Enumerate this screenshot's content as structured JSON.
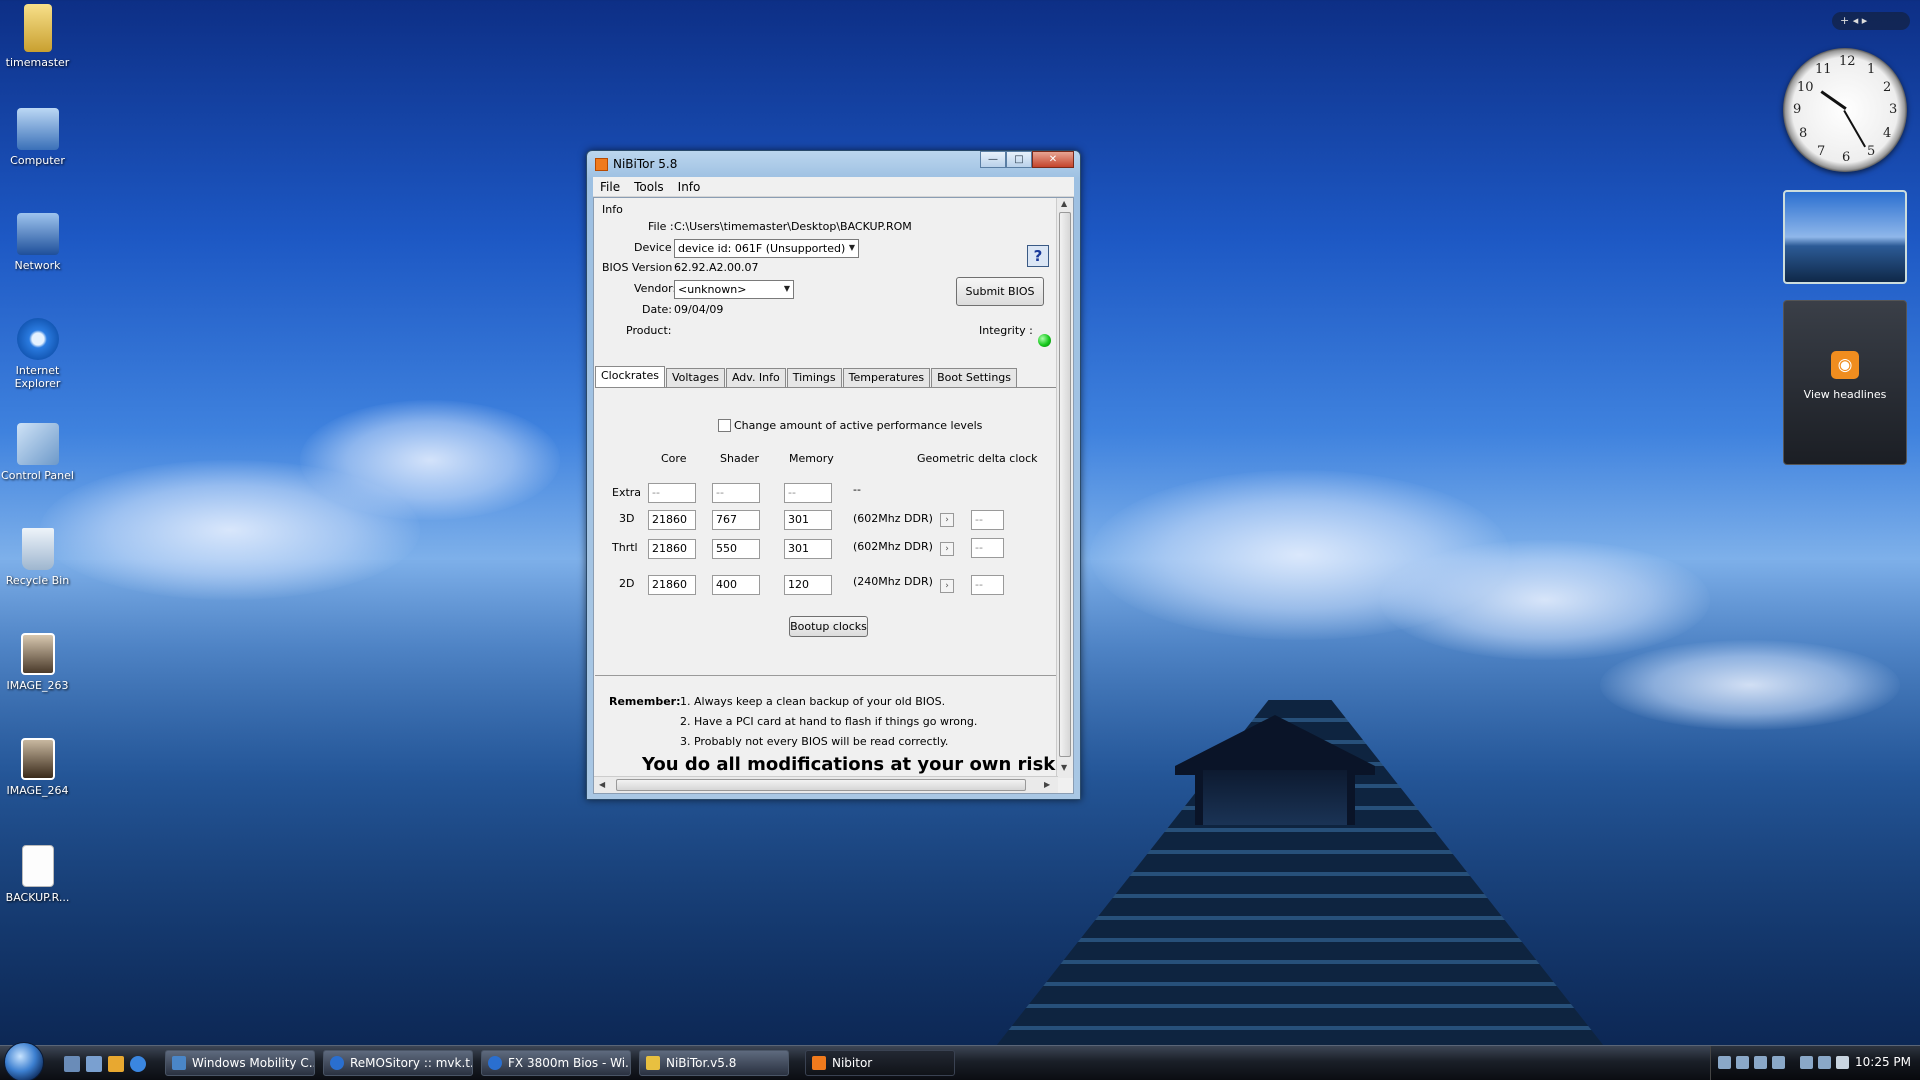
{
  "desktop": {
    "icons": [
      {
        "label": "timemaster"
      },
      {
        "label": "Computer"
      },
      {
        "label": "Network"
      },
      {
        "label": "Internet Explorer"
      },
      {
        "label": "Control Panel"
      },
      {
        "label": "Recycle Bin"
      },
      {
        "label": "IMAGE_263"
      },
      {
        "label": "IMAGE_264"
      },
      {
        "label": "BACKUP.R..."
      }
    ]
  },
  "sidebar": {
    "controls": "+  ◂ ▸",
    "rss_label": "View headlines"
  },
  "window": {
    "title": "NiBiTor 5.8",
    "controls": {
      "minimize": "—",
      "maximize": "□",
      "close": "✕"
    },
    "menu": [
      "File",
      "Tools",
      "Info"
    ],
    "info": {
      "section_label": "Info",
      "file_label": "File :",
      "file_value": "C:\\Users\\timemaster\\Desktop\\BACKUP.ROM",
      "device_label": "Device :",
      "device_value": "device id: 061F (Unsupported)",
      "bios_label": "BIOS Version :",
      "bios_value": "62.92.A2.00.07",
      "vendor_label": "Vendor:",
      "vendor_value": "<unknown>",
      "date_label": "Date:",
      "date_value": "09/04/09",
      "product_label": "Product:",
      "integrity_label": "Integrity :",
      "submit_label": "Submit BIOS",
      "help_glyph": "?"
    },
    "tabs": [
      "Clockrates",
      "Voltages",
      "Adv. Info",
      "Timings",
      "Temperatures",
      "Boot Settings"
    ],
    "clockrates": {
      "checkbox_label": "Change amount of active performance levels",
      "headers": {
        "core": "Core",
        "shader": "Shader",
        "memory": "Memory",
        "delta": "Geometric delta clock"
      },
      "rows": [
        {
          "label": "Extra",
          "core": "--",
          "shader": "--",
          "memory": "--",
          "ddr": "--",
          "delta": ""
        },
        {
          "label": "3D",
          "core": "21860",
          "shader": "767",
          "memory": "301",
          "ddr": "(602Mhz DDR)",
          "delta": "--"
        },
        {
          "label": "Thrtl",
          "core": "21860",
          "shader": "550",
          "memory": "301",
          "ddr": "(602Mhz DDR)",
          "delta": "--"
        },
        {
          "label": "2D",
          "core": "21860",
          "shader": "400",
          "memory": "120",
          "ddr": "(240Mhz DDR)",
          "delta": "--"
        }
      ],
      "arrow_glyph": "›",
      "bootup_label": "Bootup clocks"
    },
    "remember": {
      "label": "Remember:",
      "items": [
        "1. Always keep a clean backup of your old BIOS.",
        "2. Have a PCI card at hand to flash if things go wrong.",
        "3. Probably not every BIOS will be read correctly."
      ],
      "warning": "You do all modifications at your own risk!"
    }
  },
  "taskbar": {
    "tasks": [
      {
        "label": "Windows Mobility C...",
        "color": "#4a86c8"
      },
      {
        "label": "ReMOSitory :: mvk.t...",
        "color": "#2a6fd0"
      },
      {
        "label": "FX 3800m Bios - Wi...",
        "color": "#2a6fd0"
      },
      {
        "label": "NiBiTor.v5.8",
        "color": "#e8c040"
      },
      {
        "label": "Nibitor",
        "color": "#f07a1d"
      }
    ],
    "time": "10:25 PM"
  }
}
